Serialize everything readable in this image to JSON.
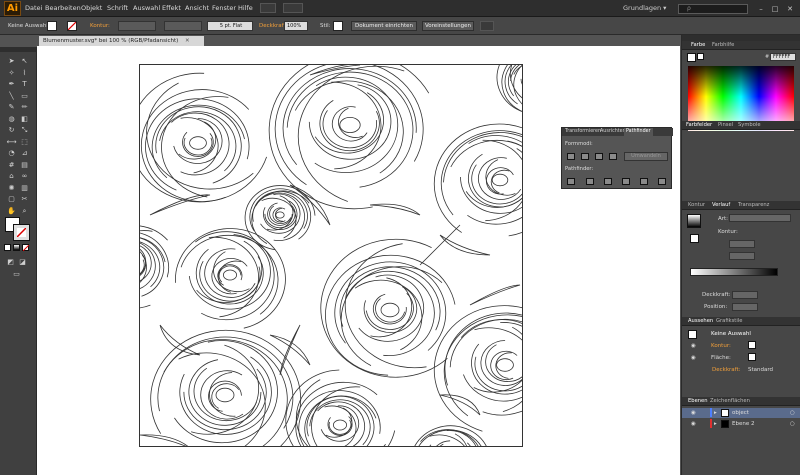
{
  "app": {
    "logo": "Ai",
    "workspace": "Grundlagen ▾",
    "search_placeholder": "ρ"
  },
  "menu": [
    "Datei",
    "Bearbeiten",
    "Objekt",
    "Schrift",
    "Auswahl",
    "Effekt",
    "Ansicht",
    "Fenster",
    "Hilfe"
  ],
  "control": {
    "selection": "Keine Auswahl",
    "stroke_label": "Kontur:",
    "stroke_style": "5 pt. Flat",
    "opacity_label": "Deckkraft:",
    "opacity_value": "100%",
    "style_label": "Stil:",
    "doc_setup": "Dokument einrichten",
    "preferences": "Voreinstellungen"
  },
  "document": {
    "tab_title": "Blumenmuster.svg* bei 100 % (RGB/Pfadansicht)"
  },
  "pathfinder": {
    "tabs": [
      "Transformieren",
      "Ausrichten",
      "Pathfinder"
    ],
    "formmodi": "Formmodi:",
    "expand": "Umwandeln",
    "pathfinder_label": "Pathfinder:"
  },
  "panels": {
    "color_tabs": [
      "Farbe",
      "Farbhilfe"
    ],
    "hex": "FFFFFF",
    "swatch_tabs": [
      "Farbfelder",
      "Pinsel",
      "Symbole"
    ],
    "stroke_tabs": [
      "Kontur",
      "Verlauf",
      "Transparenz"
    ],
    "grad_type": "Art:",
    "grad_stroke": "Kontur:",
    "opacity": "Deckkraft:",
    "position": "Position:",
    "appearance_tabs": [
      "Aussehen",
      "Grafikstile"
    ],
    "appearance_title": "Keine Auswahl",
    "app_stroke": "Kontur:",
    "app_fill": "Fläche:",
    "app_opacity": "Deckkraft:",
    "app_opacity_val": "Standard",
    "layers_tabs": [
      "Ebenen",
      "Zeichenflächen"
    ],
    "layers": [
      {
        "name": "object",
        "color": "#4f80ff"
      },
      {
        "name": "Ebene 2",
        "color": "#e03030"
      }
    ]
  }
}
